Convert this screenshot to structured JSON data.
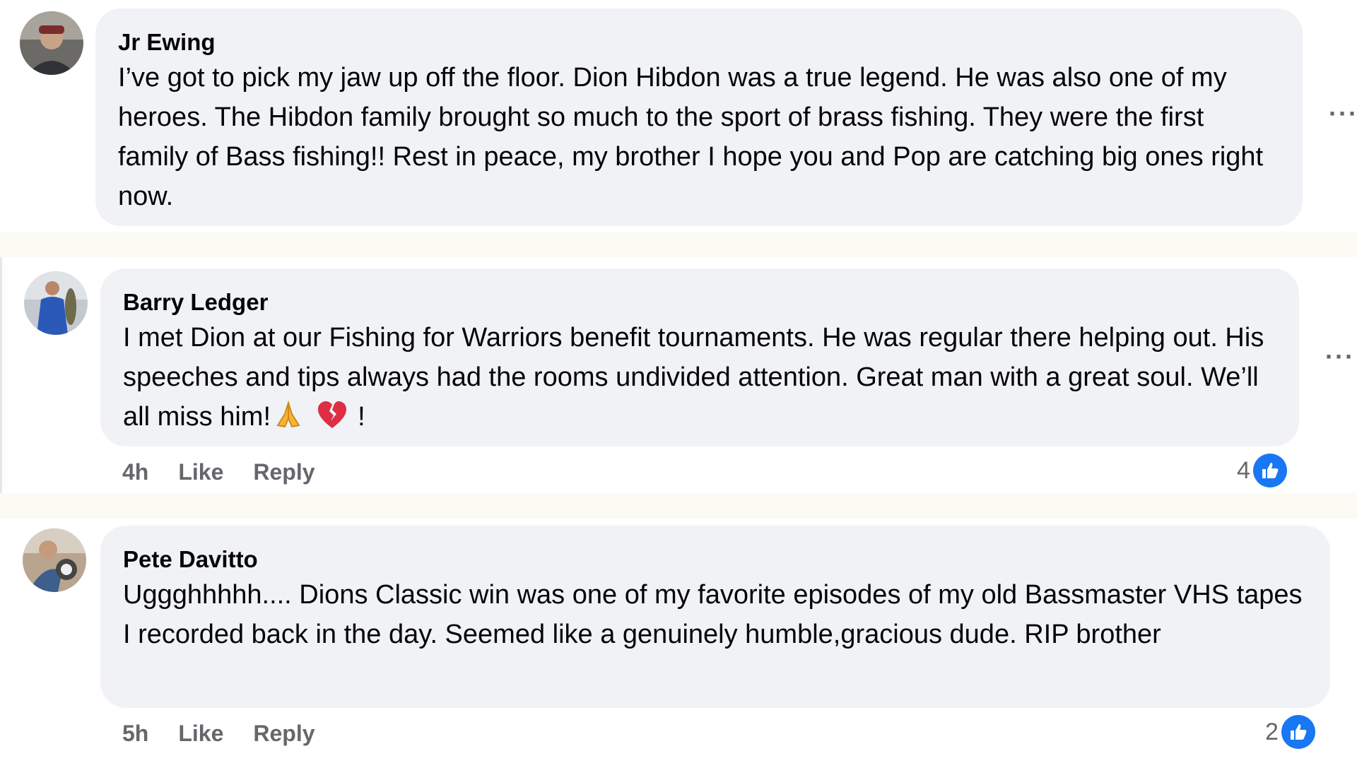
{
  "comments": [
    {
      "author": "Jr Ewing",
      "text": "I’ve got to pick my jaw up off the floor. Dion Hibdon was a true legend. He was also one of my heroes. The Hibdon family brought so much to the sport of brass fishing. They were the first family of Bass fishing!! Rest in peace, my brother I hope you and Pop are catching big ones right now.",
      "more_label": "···"
    },
    {
      "author": "Barry Ledger",
      "text": "I met Dion at our Fishing for Warriors benefit tournaments. He was regular there helping out. His speeches and tips always had the rooms undivided attention. Great man with a great soul. We’ll all miss him!",
      "text_suffix": "!",
      "emoji": [
        "folded-hands",
        "broken-heart"
      ],
      "more_label": "···",
      "time": "4h",
      "like_label": "Like",
      "reply_label": "Reply",
      "reaction_count": "4"
    },
    {
      "author": "Pete Davitto",
      "text": "Uggghhhhh.... Dions Classic win was one of my favorite episodes of my old Bassmaster VHS tapes I recorded back in the day. Seemed like a genuinely humble,gracious dude. RIP brother",
      "time": "5h",
      "like_label": "Like",
      "reply_label": "Reply",
      "reaction_count": "2"
    }
  ],
  "colors": {
    "bubble": "#f0f2f5",
    "secondary_text": "#65676b",
    "like_blue": "#1877f2",
    "separator": "#fbfaf3"
  }
}
